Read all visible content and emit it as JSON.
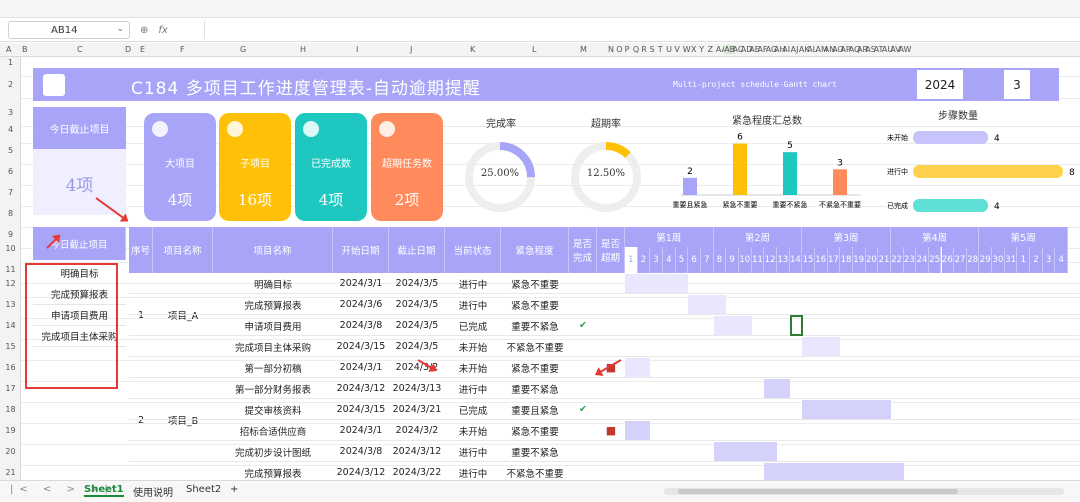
{
  "name_box": "AB14",
  "fx_label": "fx",
  "columns": [
    "A",
    "B",
    "C",
    "D",
    "E",
    "F",
    "G",
    "H",
    "I",
    "J",
    "K",
    "L",
    "M",
    "N",
    "O",
    "P",
    "Q",
    "R",
    "S",
    "T",
    "U",
    "V",
    "W",
    "X",
    "Y",
    "Z",
    "AA",
    "AB",
    "AC",
    "AD",
    "AE",
    "AF",
    "AG",
    "AH",
    "AI",
    "AJ",
    "AK",
    "AL",
    "AM",
    "AN",
    "AO",
    "AP",
    "AQ",
    "AR",
    "AS",
    "AT",
    "AU",
    "AV",
    "AW"
  ],
  "rows": [
    "1",
    "2",
    "3",
    "4",
    "5",
    "6",
    "7",
    "8",
    "9",
    "10",
    "11",
    "12",
    "13",
    "14",
    "15",
    "16",
    "17",
    "18",
    "19",
    "20",
    "21"
  ],
  "title": "C184 多项目工作进度管理表-自动逾期提醒",
  "subtitle": "Multi-project schedule-Gantt chart",
  "year": "2024",
  "month": "3",
  "today_card": {
    "header": "今日截止项目",
    "value": "4项"
  },
  "kpis": [
    {
      "label": "大项目",
      "value": "4项",
      "color": "#a8a4f8"
    },
    {
      "label": "子项目",
      "value": "16项",
      "color": "#ffc107"
    },
    {
      "label": "已完成数",
      "value": "4项",
      "color": "#1ec8c0"
    },
    {
      "label": "超期任务数",
      "value": "2项",
      "color": "#ff8a5b"
    }
  ],
  "completion": {
    "label": "完成率",
    "value": "25.00%",
    "fraction": 0.25
  },
  "overdue": {
    "label": "超期率",
    "value": "12.50%",
    "fraction": 0.125
  },
  "urgency": {
    "title": "紧急程度汇总数"
  },
  "steps": {
    "title": "步骤数量",
    "items": [
      {
        "label": "未开始",
        "value": "4"
      },
      {
        "label": "进行中",
        "value": "8"
      },
      {
        "label": "已完成",
        "value": "4"
      }
    ]
  },
  "today_list": {
    "header": "今日截止项目",
    "items": [
      "明确目标",
      "完成预算报表",
      "申请项目费用",
      "完成项目主体采购"
    ]
  },
  "table_headers": [
    "序号",
    "项目名称",
    "项目名称",
    "开始日期",
    "截止日期",
    "当前状态",
    "紧急程度",
    "是否完成",
    "是否超期"
  ],
  "weeks": [
    "第1周",
    "第2周",
    "第3周",
    "第4周",
    "第5周"
  ],
  "days": [
    "1",
    "2",
    "3",
    "4",
    "5",
    "6",
    "7",
    "8",
    "9",
    "10",
    "11",
    "12",
    "13",
    "14",
    "15",
    "16",
    "17",
    "18",
    "19",
    "20",
    "21",
    "22",
    "23",
    "24",
    "25",
    "26",
    "27",
    "28",
    "29",
    "30",
    "31",
    "1",
    "2",
    "3",
    "4"
  ],
  "groups": [
    {
      "no": "1",
      "name": "项目_A"
    },
    {
      "no": "2",
      "name": "项目_B"
    }
  ],
  "tasks": [
    {
      "name": "明确目标",
      "start": "2024/3/1",
      "end": "2024/3/5",
      "status": "进行中",
      "urgency": "紧急不重要",
      "done": "",
      "over": ""
    },
    {
      "name": "完成预算报表",
      "start": "2024/3/6",
      "end": "2024/3/5",
      "status": "进行中",
      "urgency": "紧急不重要",
      "done": "",
      "over": ""
    },
    {
      "name": "申请项目费用",
      "start": "2024/3/8",
      "end": "2024/3/5",
      "status": "已完成",
      "urgency": "重要不紧急",
      "done": "✔",
      "over": ""
    },
    {
      "name": "完成项目主体采购",
      "start": "2024/3/15",
      "end": "2024/3/5",
      "status": "未开始",
      "urgency": "不紧急不重要",
      "done": "",
      "over": ""
    },
    {
      "name": "第一部分初稿",
      "start": "2024/3/1",
      "end": "2024/3/2",
      "status": "未开始",
      "urgency": "紧急不重要",
      "done": "",
      "over": "■"
    },
    {
      "name": "第一部分财务报表",
      "start": "2024/3/12",
      "end": "2024/3/13",
      "status": "进行中",
      "urgency": "重要不紧急",
      "done": "",
      "over": ""
    },
    {
      "name": "提交审核资料",
      "start": "2024/3/15",
      "end": "2024/3/21",
      "status": "已完成",
      "urgency": "重要且紧急",
      "done": "✔",
      "over": ""
    },
    {
      "name": "招标合适供应商",
      "start": "2024/3/1",
      "end": "2024/3/2",
      "status": "未开始",
      "urgency": "紧急不重要",
      "done": "",
      "over": "■"
    },
    {
      "name": "完成初步设计图纸",
      "start": "2024/3/8",
      "end": "2024/3/12",
      "status": "进行中",
      "urgency": "重要不紧急",
      "done": "",
      "over": ""
    },
    {
      "name": "完成预算报表",
      "start": "2024/3/12",
      "end": "2024/3/22",
      "status": "进行中",
      "urgency": "不紧急不重要",
      "done": "",
      "over": ""
    }
  ],
  "sheet_tabs": [
    "Sheet1",
    "使用说明",
    "Sheet2",
    "+"
  ],
  "chart_data": [
    {
      "type": "bar",
      "title": "紧急程度汇总数",
      "categories": [
        "重要且紧急",
        "紧急不重要",
        "重要不紧急",
        "不紧急不重要"
      ],
      "values": [
        2,
        6,
        5,
        3
      ],
      "colors": [
        "#a8a4f8",
        "#ffc107",
        "#1ec8c0",
        "#ff8a5b"
      ]
    },
    {
      "type": "bar",
      "title": "步骤数量",
      "categories": [
        "未开始",
        "进行中",
        "已完成"
      ],
      "values": [
        4,
        8,
        4
      ],
      "colors": [
        "#c7c3fb",
        "#ffd24d",
        "#5fe0d6"
      ]
    }
  ]
}
